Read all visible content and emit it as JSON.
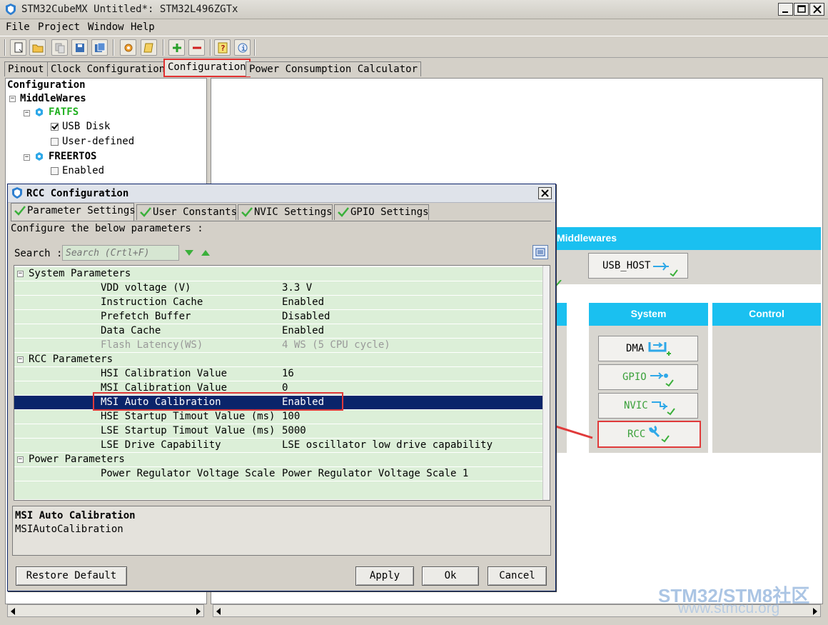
{
  "window": {
    "title": "STM32CubeMX Untitled*: STM32L496ZGTx"
  },
  "menu": [
    "File",
    "Project",
    "Window",
    "Help"
  ],
  "main_tabs": [
    "Pinout",
    "Clock Configuration",
    "Configuration",
    "Power Consumption Calculator"
  ],
  "tree": {
    "root": "Configuration",
    "middlewares": "MiddleWares",
    "fatfs": "FATFS",
    "usb_disk": "USB Disk",
    "user_defined": "User-defined",
    "freertos": "FREERTOS",
    "enabled": "Enabled"
  },
  "right": {
    "middlewares_header": "Middlewares",
    "usb_host": "USB_HOST",
    "system_header": "System",
    "control_header": "Control",
    "system_buttons": [
      "DMA",
      "GPIO",
      "NVIC",
      "RCC"
    ]
  },
  "dialog": {
    "title": "RCC Configuration",
    "tabs": [
      "Parameter Settings",
      "User Constants",
      "NVIC Settings",
      "GPIO Settings"
    ],
    "instruction": "Configure the below parameters :",
    "search_label": "Search :",
    "search_placeholder": "Search (Crtl+F)",
    "groups": [
      {
        "name": "System Parameters",
        "rows": [
          {
            "name": "VDD voltage (V)",
            "value": "3.3 V"
          },
          {
            "name": "Instruction Cache",
            "value": "Enabled"
          },
          {
            "name": "Prefetch Buffer",
            "value": "Disabled"
          },
          {
            "name": "Data Cache",
            "value": "Enabled"
          },
          {
            "name": "Flash Latency(WS)",
            "value": "4 WS (5 CPU cycle)"
          }
        ]
      },
      {
        "name": "RCC Parameters",
        "rows": [
          {
            "name": "HSI Calibration Value",
            "value": "16"
          },
          {
            "name": "MSI Calibration Value",
            "value": "0"
          },
          {
            "name": "MSI Auto Calibration",
            "value": "Enabled"
          },
          {
            "name": "HSE Startup Timout Value (ms)",
            "value": "100"
          },
          {
            "name": "LSE Startup Timout Value (ms)",
            "value": "5000"
          },
          {
            "name": "LSE Drive Capability",
            "value": "LSE oscillator low drive capability"
          }
        ]
      },
      {
        "name": "Power Parameters",
        "rows": [
          {
            "name": "Power Regulator Voltage Scale",
            "value": "Power Regulator Voltage Scale 1"
          }
        ]
      }
    ],
    "desc_title": "MSI Auto Calibration",
    "desc_text": "MSIAutoCalibration",
    "buttons": {
      "restore": "Restore Default",
      "apply": "Apply",
      "ok": "Ok",
      "cancel": "Cancel"
    }
  },
  "watermark": {
    "line1": "STM32/STM8社区",
    "line2": "www.stmcu.org"
  },
  "colors": {
    "accent": "#1ac0f0",
    "highlight": "#e03030",
    "selection": "#0a246a",
    "row_green": "#dcefd8"
  }
}
